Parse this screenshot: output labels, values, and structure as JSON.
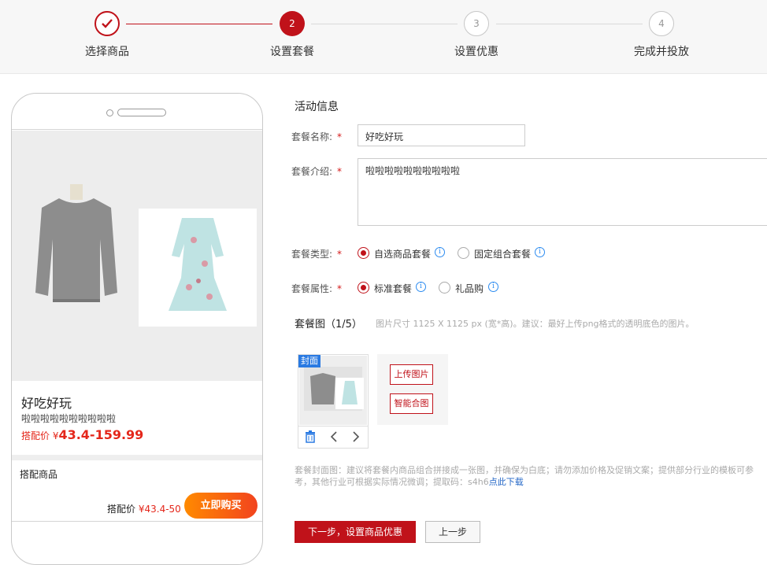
{
  "steps": [
    {
      "number": "✓",
      "label": "选择商品",
      "state": "done"
    },
    {
      "number": "2",
      "label": "设置套餐",
      "state": "active"
    },
    {
      "number": "3",
      "label": "设置优惠",
      "state": "todo"
    },
    {
      "number": "4",
      "label": "完成并投放",
      "state": "todo"
    }
  ],
  "colors": {
    "accent": "#c0121a",
    "price": "#e4271b",
    "link": "#2467c7"
  },
  "preview": {
    "title": "好吃好玩",
    "desc": "啦啦啦啦啦啦啦啦啦啦",
    "price_label": "搭配价 ¥",
    "price": "43.4-159.99",
    "match_label": "搭配商品",
    "match_price_label": "搭配价",
    "match_price": "¥43.4-50",
    "buy_label": "立即购买"
  },
  "form": {
    "section_title": "活动信息",
    "name_label": "套餐名称:",
    "name_value": "好吃好玩",
    "intro_label": "套餐介绍:",
    "intro_value": "啦啦啦啦啦啦啦啦啦啦",
    "type_label": "套餐类型:",
    "type_options": [
      "自选商品套餐",
      "固定组合套餐"
    ],
    "attr_label": "套餐属性:",
    "attr_options": [
      "标准套餐",
      "礼品购"
    ],
    "required_mark": "*",
    "info_glyph": "i"
  },
  "images": {
    "title": "套餐图（1/5）",
    "hint": "图片尺寸 1125 X 1125 px (宽*高)。建议：最好上传png格式的透明底色的图片。",
    "cover_tag": "封面",
    "upload_label": "上传图片",
    "smart_label": "智能合图",
    "note": "套餐封面图：建议将套餐内商品组合拼接成一张图，并确保为白底；请勿添加价格及促销文案；提供部分行业的模板可参考，其他行业可根据实际情况微调；提取码：s4h6",
    "note_link": "点此下载"
  },
  "actions": {
    "next_label": "下一步，设置商品优惠",
    "prev_label": "上一步"
  }
}
